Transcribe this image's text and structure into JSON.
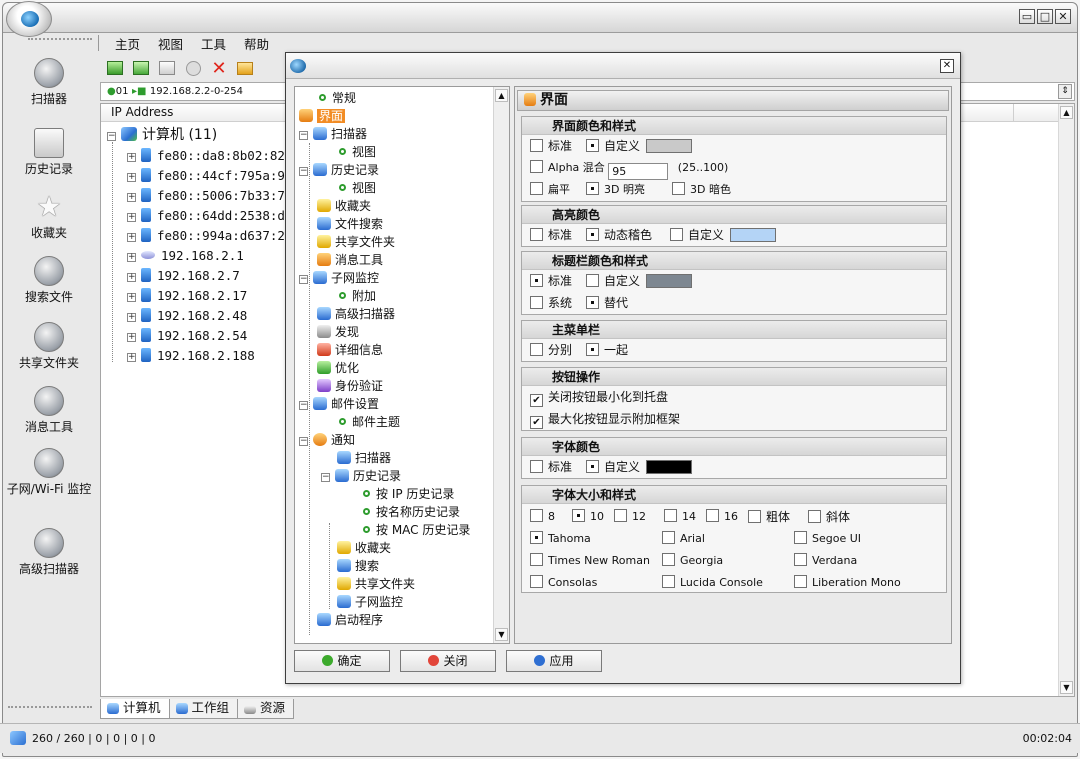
{
  "window": {
    "controls": [
      "▭",
      "□",
      "✕"
    ]
  },
  "menu": [
    "主页",
    "视图",
    "工具",
    "帮助"
  ],
  "address": "192.168.2.2-0-254",
  "address_prefix": "01",
  "left_nav": [
    {
      "label": "扫描器"
    },
    {
      "label": "历史记录"
    },
    {
      "label": "收藏夹"
    },
    {
      "label": "搜索文件"
    },
    {
      "label": "共享文件夹"
    },
    {
      "label": "消息工具"
    },
    {
      "label": "子网/Wi-Fi 监控"
    },
    {
      "label": "高级扫描器"
    }
  ],
  "list": {
    "header": "IP Address",
    "root": "计算机 (11)",
    "rows": [
      "fe80::da8:8b02:82",
      "fe80::44cf:795a:93",
      "fe80::5006:7b33:7",
      "fe80::64dd:2538:d",
      "fe80::994a:d637:2",
      "192.168.2.1",
      "192.168.2.7",
      "192.168.2.17",
      "192.168.2.48",
      "192.168.2.54",
      "192.168.2.188"
    ]
  },
  "bottom_tabs": [
    "计算机",
    "工作组",
    "资源"
  ],
  "status": {
    "left": "260 / 260 | 0 | 0 | 0 | 0",
    "right": "00:02:04"
  },
  "dialog": {
    "close": "✕",
    "tree": [
      "常规",
      "界面",
      "扫描器",
      "视图",
      "历史记录",
      "视图",
      "收藏夹",
      "文件搜索",
      "共享文件夹",
      "消息工具",
      "子网监控",
      "附加",
      "高级扫描器",
      "发现",
      "详细信息",
      "优化",
      "身份验证",
      "邮件设置",
      "邮件主题",
      "通知",
      "扫描器",
      "历史记录",
      "按 IP 历史记录",
      "按名称历史记录",
      "按 MAC 历史记录",
      "收藏夹",
      "搜索",
      "共享文件夹",
      "子网监控",
      "启动程序"
    ],
    "buttons": {
      "ok": "确定",
      "close": "关闭",
      "apply": "应用"
    },
    "panel_title": "界面",
    "groups": {
      "style": {
        "title": "界面颜色和样式",
        "standard": "标准",
        "custom": "自定义",
        "alpha": "Alpha 混合",
        "alpha_value": "95",
        "alpha_range": "(25..100)",
        "flat": "扁平",
        "bright3d": "3D 明亮",
        "dark3d": "3D 暗色",
        "swatch": "#c9c9c9"
      },
      "highlight": {
        "title": "高亮颜色",
        "standard": "标准",
        "dynamic": "动态稽色",
        "custom": "自定义",
        "swatch": "#b4d4f6"
      },
      "titlebar": {
        "title": "标题栏颜色和样式",
        "standard": "标准",
        "custom": "自定义",
        "system": "系统",
        "alternate": "替代",
        "swatch": "#7d8791"
      },
      "mainmenu": {
        "title": "主菜单栏",
        "separate": "分别",
        "together": "一起"
      },
      "buttons": {
        "title": "按钮操作",
        "minimize_tray": "关闭按钮最小化到托盘",
        "maximize_frame": "最大化按钮显示附加框架"
      },
      "fontcolor": {
        "title": "字体颜色",
        "standard": "标准",
        "custom": "自定义",
        "swatch": "#000000"
      },
      "fontsize": {
        "title": "字体大小和样式",
        "sizes": [
          "8",
          "10",
          "12",
          "14",
          "16"
        ],
        "bold": "粗体",
        "italic": "斜体",
        "fonts": [
          "Tahoma",
          "Arial",
          "Segoe UI",
          "Times New Roman",
          "Georgia",
          "Verdana",
          "Consolas",
          "Lucida Console",
          "Liberation Mono"
        ]
      }
    }
  }
}
